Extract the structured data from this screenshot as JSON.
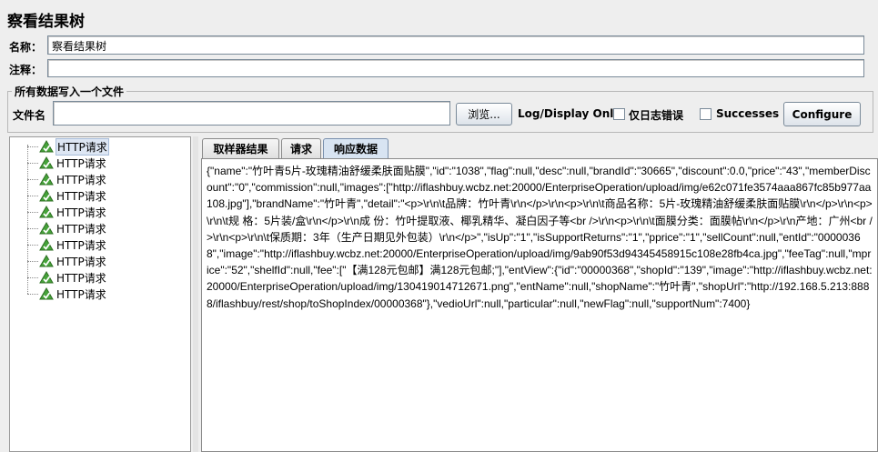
{
  "title": "察看结果树",
  "name_label": "名称：",
  "name_value": "察看结果树",
  "comment_label": "注释：",
  "comment_value": "",
  "group_title": "所有数据写入一个文件",
  "filename_label": "文件名",
  "filename_value": "",
  "browse_label": "浏览...",
  "log_display_label": "Log/Display Only:",
  "errors_label": "仅日志错误",
  "successes_label": "Successes",
  "configure_label": "Configure",
  "tree_items": [
    "HTTP请求",
    "HTTP请求",
    "HTTP请求",
    "HTTP请求",
    "HTTP请求",
    "HTTP请求",
    "HTTP请求",
    "HTTP请求",
    "HTTP请求",
    "HTTP请求"
  ],
  "tabs": [
    "取样器结果",
    "请求",
    "响应数据"
  ],
  "active_tab": 2,
  "response_text": "{\"name\":\"竹叶青5片-玫瑰精油舒缓柔肤面贴膜\",\"id\":\"1038\",\"flag\":null,\"desc\":null,\"brandId\":\"30665\",\"discount\":0.0,\"price\":\"43\",\"memberDiscount\":\"0\",\"commission\":null,\"images\":[\"http://iflashbuy.wcbz.net:20000/EnterpriseOperation/upload/img/e62c071fe3574aaa867fc85b977aa108.jpg\"],\"brandName\":\"竹叶青\",\"detail\":\"<p>\\r\\n\\t品牌：竹叶青\\r\\n</p>\\r\\n<p>\\r\\n\\t商品名称：5片-玫瑰精油舒缓柔肤面贴膜\\r\\n</p>\\r\\n<p>\\r\\n\\t规 格：5片装/盒\\r\\n</p>\\r\\n成 份：竹叶提取液、椰乳精华、凝白因子等<br />\\r\\n<p>\\r\\n\\t面膜分类：面膜帖\\r\\n</p>\\r\\n产地：广州<br />\\r\\n<p>\\r\\n\\t保质期：3年（生产日期见外包装）\\r\\n</p>\",\"isUp\":\"1\",\"isSupportReturns\":\"1\",\"pprice\":\"1\",\"sellCount\":null,\"entId\":\"00000368\",\"image\":\"http://iflashbuy.wcbz.net:20000/EnterpriseOperation/upload/img/9ab90f53d94345458915c108e28fb4ca.jpg\",\"feeTag\":null,\"mprice\":\"52\",\"shelfId\":null,\"fee\":[\"【满128元包邮】满128元包邮;\"],\"entView\":{\"id\":\"00000368\",\"shopId\":\"139\",\"image\":\"http://iflashbuy.wcbz.net:20000/EnterpriseOperation/upload/img/130419014712671.png\",\"entName\":null,\"shopName\":\"竹叶青\",\"shopUrl\":\"http://192.168.5.213:8888/iflashbuy/rest/shop/toShopIndex/00000368\"},\"vedioUrl\":null,\"particular\":null,\"newFlag\":null,\"supportNum\":7400}",
  "colors": {
    "background": "#eeeeee",
    "active_tab": "#d8e4f2",
    "selection": "#dde6f3",
    "icon_green": "#3d8b2f"
  }
}
